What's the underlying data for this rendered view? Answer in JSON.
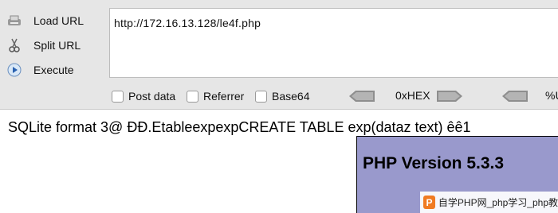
{
  "hackbar": {
    "commands": [
      {
        "label": "Load URL",
        "icon": "load-url-icon"
      },
      {
        "label": "Split URL",
        "icon": "split-url-icon"
      },
      {
        "label": "Execute",
        "icon": "execute-icon"
      }
    ],
    "url_value": "http://172.16.13.128/le4f.php",
    "options": {
      "post_data": "Post data",
      "referrer": "Referrer",
      "base64": "Base64"
    },
    "encoding": {
      "hex_label": "0xHEX",
      "url_label": "%U"
    }
  },
  "page": {
    "text_line": "SQLite format 3@  ĐĐ.EtableexpexpCREATE TABLE exp(dataz text) êê1",
    "php_header": "PHP Version 5.3.3"
  },
  "watermark": {
    "logo_letter": "P",
    "text": "自学PHP网_php学习_php教"
  },
  "colors": {
    "toolbar_bg": "#e6e6e6",
    "php_header_bg": "#9999cc",
    "watermark_logo": "#f07b22"
  }
}
